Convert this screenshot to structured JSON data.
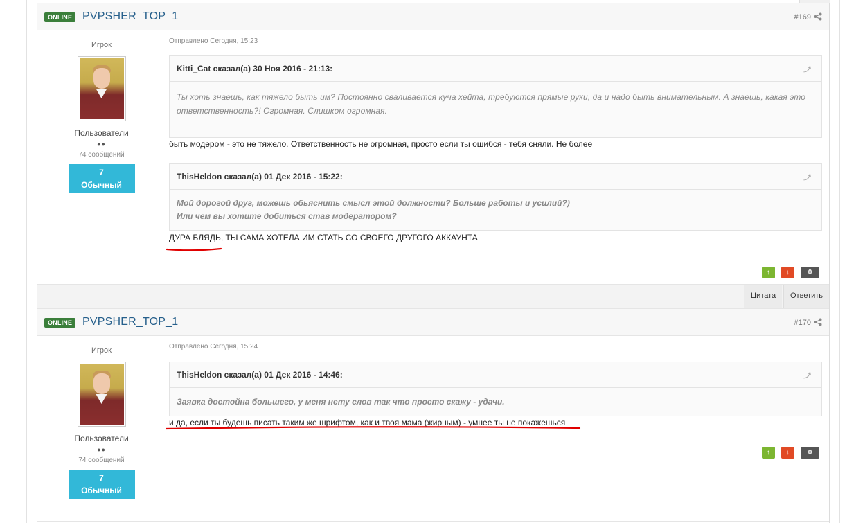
{
  "posts": [
    {
      "badge": "ONLINE",
      "username": "PVPSHER_TOP_1",
      "post_number": "#169",
      "author": {
        "role": "Игрок",
        "group": "Пользователи",
        "dots": "●●",
        "message_count": "74 сообщений",
        "rep_value": "7",
        "rep_label": "Обычный"
      },
      "posted": "Отправлено Сегодня, 15:23",
      "quote1": {
        "header": "Kitti_Cat сказал(а) 30 Ноя 2016 - 21:13:",
        "text": "Ты хоть знаешь, как тяжело быть им? Постоянно сваливается куча хейта, требуются прямые руки, да и надо быть внимательным. А знаешь, какая это ответственность?! Огромная. Слишком огромная."
      },
      "reply1": "быть модером - это не тяжело. Ответственность не огромная, просто если ты ошибся -  тебя сняли. Не более",
      "quote2": {
        "header": "ThisHeldon сказал(а) 01 Дек 2016 - 15:22:",
        "line1": "Мой дорогой друг, можешь обьяснить смысл этой должности? Больше работы и усилий?)",
        "line2": "Или чем вы хотите добиться став модератором?"
      },
      "reply2": "ДУРА БЛЯДЬ, ТЫ САМА ХОТЕЛА ИМ СТАТЬ СО СВОЕГО ДРУГОГО АККАУНТА",
      "score": "0"
    },
    {
      "badge": "ONLINE",
      "username": "PVPSHER_TOP_1",
      "post_number": "#170",
      "author": {
        "role": "Игрок",
        "group": "Пользователи",
        "dots": "●●",
        "message_count": "74 сообщений",
        "rep_value": "7",
        "rep_label": "Обычный"
      },
      "posted": "Отправлено Сегодня, 15:24",
      "quote1": {
        "header": "ThisHeldon сказал(а) 01 Дек 2016 - 14:46:",
        "text": "Заявка достойна большего, у меня нету слов так что просто скажу - удачи."
      },
      "reply1": "и да, если ты будешь писать таким же шрифтом, как и твоя мама (жирным) - умнее ты не покажешься",
      "score": "0"
    }
  ],
  "actions": {
    "quote_label": "Цитата",
    "reply_label": "Ответить"
  },
  "icons": {
    "share": "share-icon",
    "quote_jump": "quote-jump-icon",
    "vote_up": "arrow-up-icon",
    "vote_down": "arrow-down-icon"
  },
  "colors": {
    "online_badge": "#3b7f3b",
    "username": "#27608c",
    "rep_box": "#32b8d8",
    "vote_up": "#7cb631",
    "vote_down": "#e14a25",
    "annotation_underline": "#e00000"
  }
}
